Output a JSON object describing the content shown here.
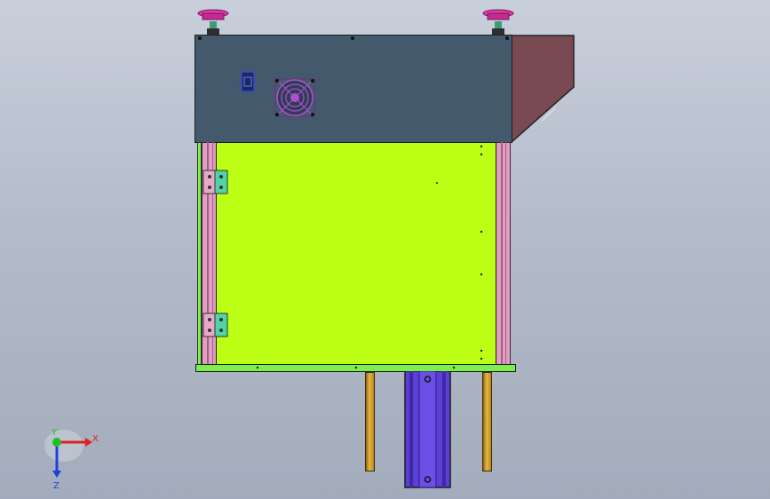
{
  "viewport": {
    "background_top": "#c9cfdb",
    "background_bottom": "#a3acbc"
  },
  "model": {
    "parts": [
      {
        "name": "top-housing",
        "color": "#44596c"
      },
      {
        "name": "slanted-cover",
        "color": "#7a4a52"
      },
      {
        "name": "front-door-panel",
        "color": "#bcff14"
      },
      {
        "name": "side-rail",
        "color": "#e39cc2"
      },
      {
        "name": "hinge",
        "color": "#4fd4a8"
      },
      {
        "name": "base-plate",
        "color": "#7cf04a"
      },
      {
        "name": "support-rod",
        "color": "#d7a128"
      },
      {
        "name": "linear-actuator",
        "color": "#5b3fd6"
      },
      {
        "name": "leveling-foot",
        "color": "#e23aa8"
      },
      {
        "name": "cooling-fan",
        "color": "#b14fd3"
      },
      {
        "name": "power-socket",
        "color": "#3a49c8"
      }
    ]
  },
  "triad": {
    "x_label": "X",
    "y_label": "Y",
    "z_label": "Z",
    "x_color": "#e02020",
    "y_color": "#20c020",
    "z_color": "#2040e0"
  }
}
